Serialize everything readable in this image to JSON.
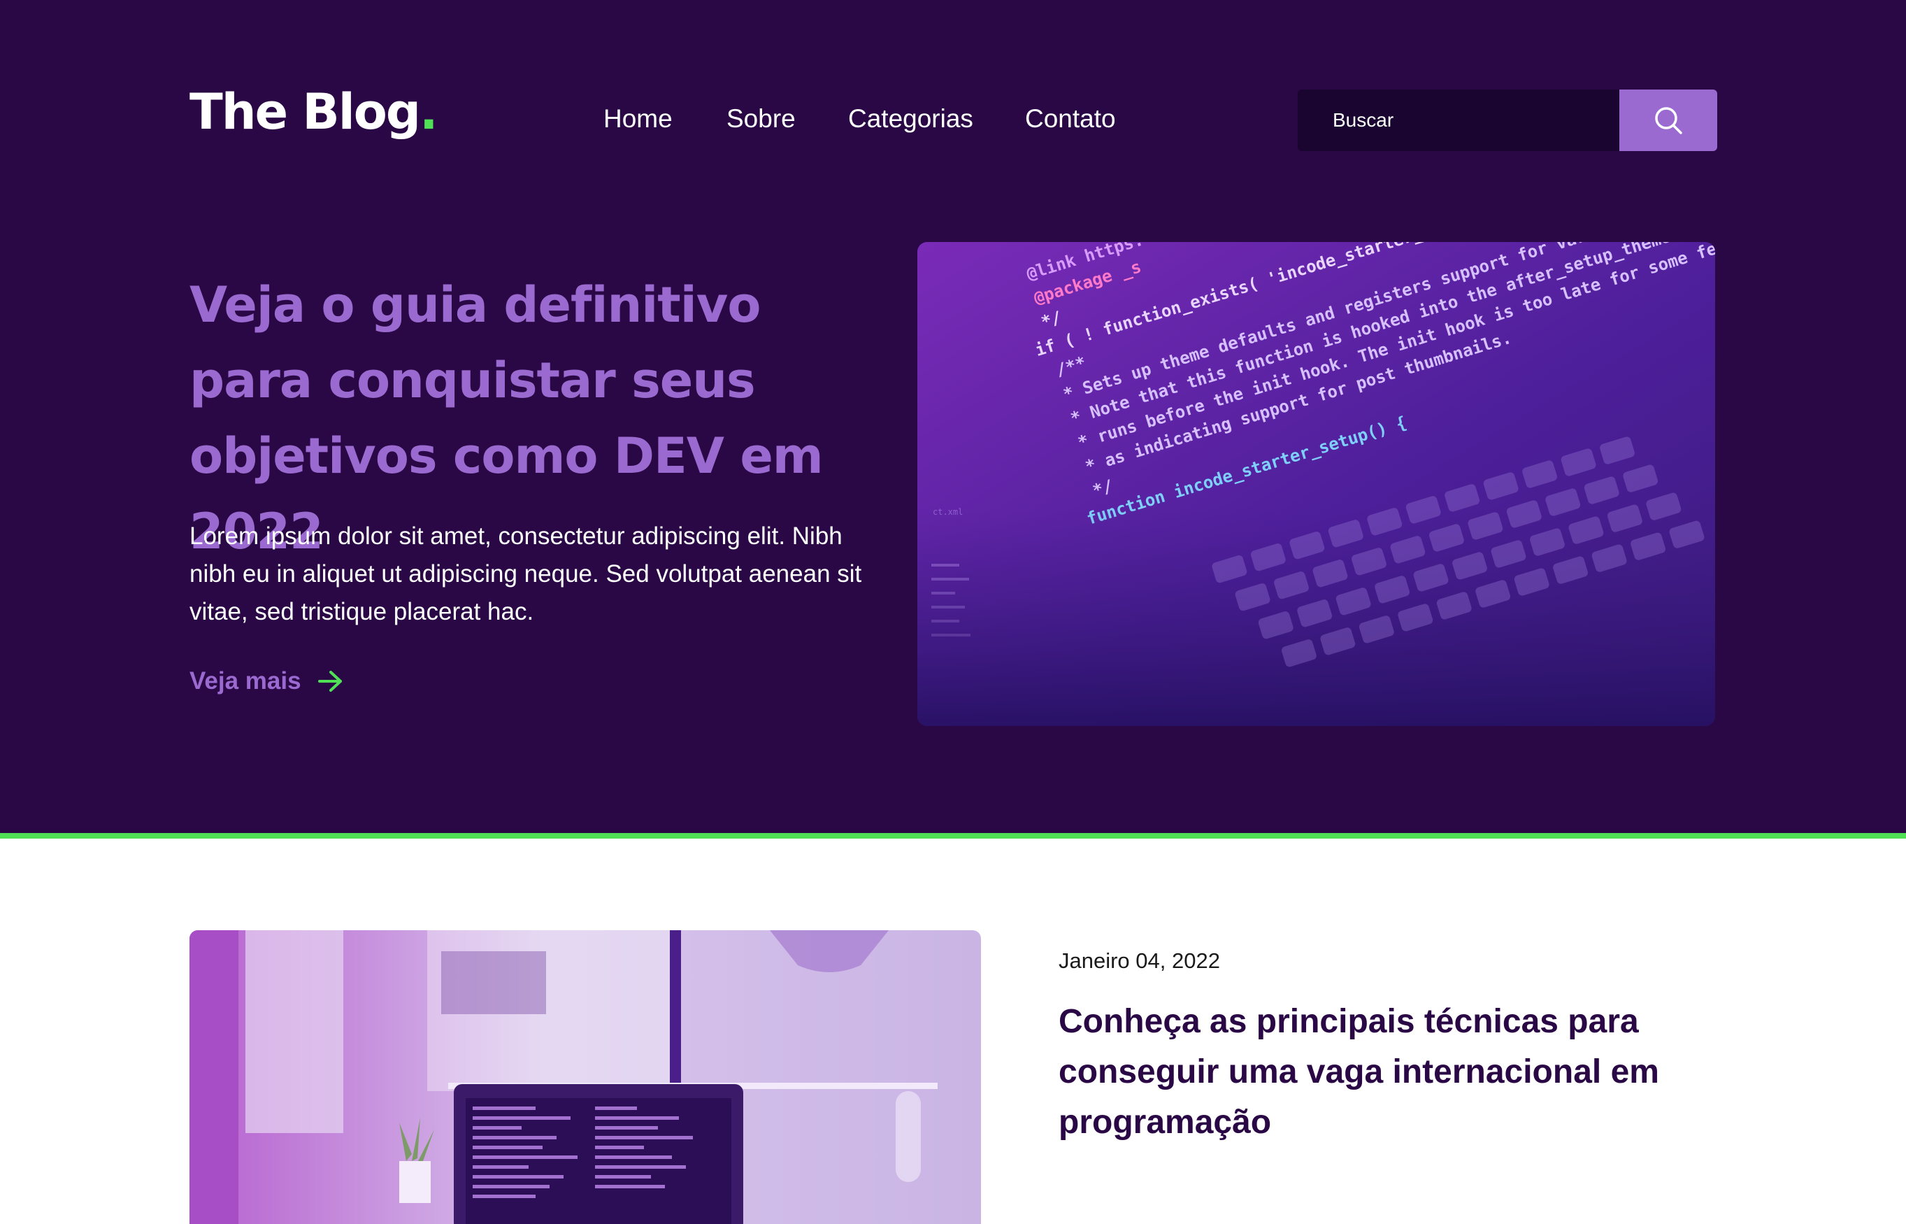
{
  "header": {
    "logo_text": "The Blog",
    "logo_dot": ".",
    "nav": [
      "Home",
      "Sobre",
      "Categorias",
      "Contato"
    ],
    "search_placeholder": "Buscar",
    "search_icon": "search-icon"
  },
  "hero": {
    "title": "Veja o guia definitivo para conquistar seus objetivos como DEV em 2022",
    "text": "Lorem ipsum dolor sit amet, consectetur adipiscing elit. Nibh nibh eu in aliquet ut adipiscing neque. Sed volutpat aenean sit vitae, sed tristique placerat hac.",
    "link_label": "Veja mais",
    "link_icon": "arrow-right-icon",
    "image_code_lines": [
      "@link https:",
      "@package _s",
      "*/",
      "if ( ! function_exists( 'incode_starter_setup' ) ) :",
      "/**",
      "* Sets up theme defaults and registers support for various WordPress features.",
      "* Note that this function is hooked into the after_setup_theme hook, which",
      "* runs before the init hook. The init hook is too late for some features, such",
      "* as indicating support for post thumbnails.",
      "*/",
      "function incode_starter_setup() {"
    ]
  },
  "post": {
    "date": "Janeiro 04, 2022",
    "title": "Conheça as principais técnicas para conseguir uma vaga internacional em programação"
  },
  "colors": {
    "hero_bg": "#2a0845",
    "accent_purple": "#9b6ad0",
    "accent_green": "#4fe055",
    "search_bg": "#1a0430"
  }
}
